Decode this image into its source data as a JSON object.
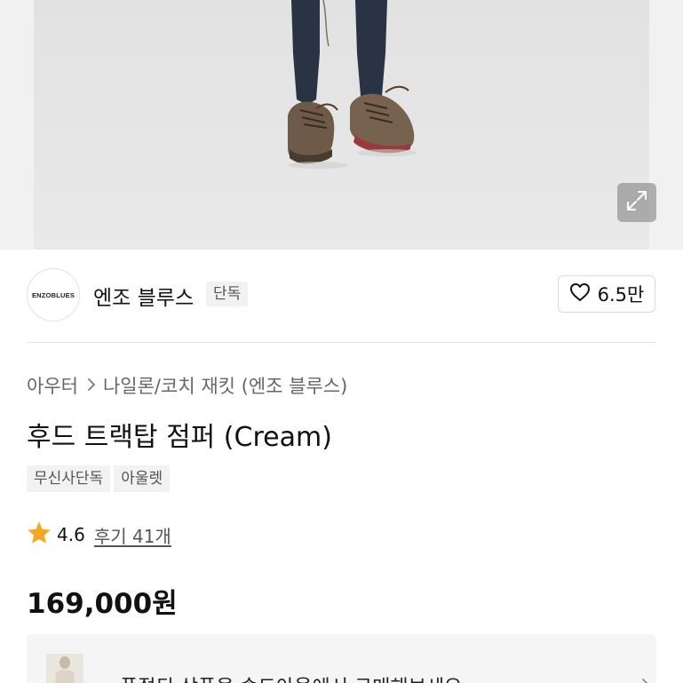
{
  "hero": {
    "expand_icon": "expand-arrows-icon"
  },
  "brand": {
    "logo_text": "ENZOBLUES",
    "name": "엔조 블루스",
    "exclusive_badge": "단독",
    "like_icon": "heart-outline-icon",
    "like_count": "6.5만"
  },
  "category": {
    "primary": "아우터",
    "separator_icon": "chevron-right-icon",
    "secondary": "나일론/코치 재킷 (엔조 블루스)"
  },
  "product": {
    "title": "후드 트랙탑 점퍼 (Cream)",
    "tags": [
      "무신사단독",
      "아울렛"
    ],
    "rating_icon": "star-icon",
    "rating_color": "#f5a623",
    "rating_score": "4.6",
    "review_label": "후기 41개",
    "price": "169,000원"
  },
  "promo": {
    "text": "품절된 상품을 솔드아웃에서 구매해보세요",
    "chevron_icon": "chevron-right-icon"
  }
}
